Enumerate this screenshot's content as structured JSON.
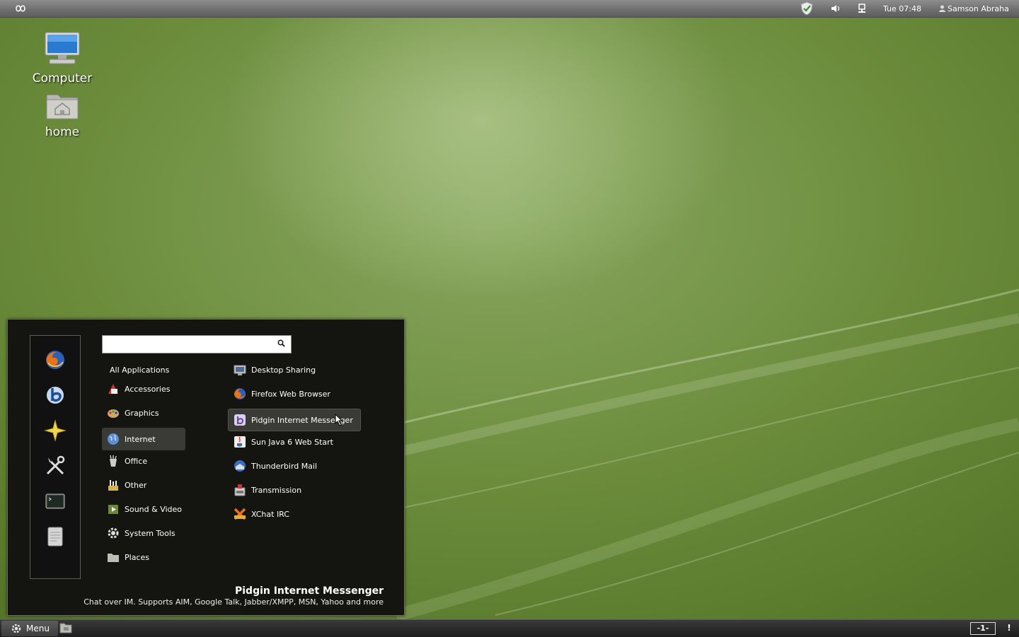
{
  "top_panel": {
    "clock": "Tue 07:48",
    "user": "Samson Abraha"
  },
  "desktop": {
    "icons": [
      {
        "label": "Computer"
      },
      {
        "label": "home"
      }
    ]
  },
  "menu": {
    "search": {
      "value": "",
      "placeholder": ""
    },
    "categories": [
      {
        "label": "All Applications"
      },
      {
        "label": "Accessories"
      },
      {
        "label": "Graphics"
      },
      {
        "label": "Internet"
      },
      {
        "label": "Office"
      },
      {
        "label": "Other"
      },
      {
        "label": "Sound & Video"
      },
      {
        "label": "System Tools"
      },
      {
        "label": "Places"
      }
    ],
    "selected_category": "Internet",
    "apps": [
      {
        "label": "Desktop Sharing"
      },
      {
        "label": "Firefox Web Browser"
      },
      {
        "label": "Pidgin Internet Messenger"
      },
      {
        "label": "Sun Java 6 Web Start"
      },
      {
        "label": "Thunderbird Mail"
      },
      {
        "label": "Transmission"
      },
      {
        "label": "XChat IRC"
      }
    ],
    "description": {
      "title": "Pidgin Internet Messenger",
      "text": "Chat over IM.  Supports AIM, Google Talk, Jabber/XMPP, MSN, Yahoo and more"
    }
  },
  "bottom_panel": {
    "menu_label": "Menu",
    "workspace": "-1-",
    "notification": "!"
  }
}
